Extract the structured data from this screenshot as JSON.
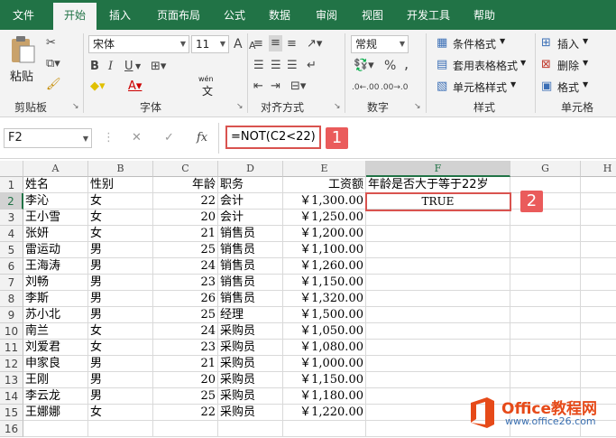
{
  "tabs": [
    "文件",
    "开始",
    "插入",
    "页面布局",
    "公式",
    "数据",
    "审阅",
    "视图",
    "开发工具",
    "帮助"
  ],
  "ribbon": {
    "clipboard": {
      "paste_label": "粘贴",
      "group_label": "剪贴板"
    },
    "font": {
      "font_name": "宋体",
      "font_size": "11",
      "bold": "B",
      "italic": "I",
      "underline": "U",
      "grow": "A",
      "shrink": "A",
      "phonetic": "wén",
      "phonetic_char": "文",
      "group_label": "字体"
    },
    "align": {
      "group_label": "对齐方式"
    },
    "number": {
      "format": "常规",
      "percent": "%",
      "comma": ",",
      "dec_inc": ".0←.00",
      "dec_dec": ".00→.0",
      "group_label": "数字"
    },
    "styles": {
      "cond": "条件格式",
      "table": "套用表格格式",
      "cell": "单元格样式",
      "group_label": "样式"
    },
    "cells": {
      "insert": "插入",
      "delete": "删除",
      "format": "格式",
      "group_label": "单元格"
    }
  },
  "formula_bar": {
    "name_box": "F2",
    "cancel": "✕",
    "enter": "✓",
    "fx": "fx",
    "formula": "=NOT(C2<22)"
  },
  "callouts": {
    "one": "1",
    "two": "2"
  },
  "columns": [
    "A",
    "B",
    "C",
    "D",
    "E",
    "F",
    "G",
    "H"
  ],
  "rows": [
    {
      "n": "1",
      "a": "姓名",
      "b": "性别",
      "c": "年龄",
      "d": "职务",
      "e": "工资额",
      "f": "年龄是否大于等于22岁"
    },
    {
      "n": "2",
      "a": "李沁",
      "b": "女",
      "c": "22",
      "d": "会计",
      "e": "￥1,300.00",
      "f": "TRUE"
    },
    {
      "n": "3",
      "a": "王小雪",
      "b": "女",
      "c": "20",
      "d": "会计",
      "e": "￥1,250.00",
      "f": ""
    },
    {
      "n": "4",
      "a": "张妍",
      "b": "女",
      "c": "21",
      "d": "销售员",
      "e": "￥1,200.00",
      "f": ""
    },
    {
      "n": "5",
      "a": "雷运动",
      "b": "男",
      "c": "25",
      "d": "销售员",
      "e": "￥1,100.00",
      "f": ""
    },
    {
      "n": "6",
      "a": "王海涛",
      "b": "男",
      "c": "24",
      "d": "销售员",
      "e": "￥1,260.00",
      "f": ""
    },
    {
      "n": "7",
      "a": "刘畅",
      "b": "男",
      "c": "23",
      "d": "销售员",
      "e": "￥1,150.00",
      "f": ""
    },
    {
      "n": "8",
      "a": "李斯",
      "b": "男",
      "c": "26",
      "d": "销售员",
      "e": "￥1,320.00",
      "f": ""
    },
    {
      "n": "9",
      "a": "苏小北",
      "b": "男",
      "c": "25",
      "d": "经理",
      "e": "￥1,500.00",
      "f": ""
    },
    {
      "n": "10",
      "a": "南兰",
      "b": "女",
      "c": "24",
      "d": "采购员",
      "e": "￥1,050.00",
      "f": ""
    },
    {
      "n": "11",
      "a": "刘爱君",
      "b": "女",
      "c": "23",
      "d": "采购员",
      "e": "￥1,080.00",
      "f": ""
    },
    {
      "n": "12",
      "a": "申家良",
      "b": "男",
      "c": "21",
      "d": "采购员",
      "e": "￥1,000.00",
      "f": ""
    },
    {
      "n": "13",
      "a": "王刚",
      "b": "男",
      "c": "20",
      "d": "采购员",
      "e": "￥1,150.00",
      "f": ""
    },
    {
      "n": "14",
      "a": "李云龙",
      "b": "男",
      "c": "25",
      "d": "采购员",
      "e": "￥1,180.00",
      "f": ""
    },
    {
      "n": "15",
      "a": "王娜娜",
      "b": "女",
      "c": "22",
      "d": "采购员",
      "e": "￥1,220.00",
      "f": ""
    },
    {
      "n": "16",
      "a": "",
      "b": "",
      "c": "",
      "d": "",
      "e": "",
      "f": ""
    }
  ],
  "watermark": {
    "brand": "Office教程网",
    "url": "www.office26.com"
  },
  "colors": {
    "excel_green": "#217346",
    "callout_red": "#ea5b5b",
    "selection_red": "#d9534f"
  }
}
